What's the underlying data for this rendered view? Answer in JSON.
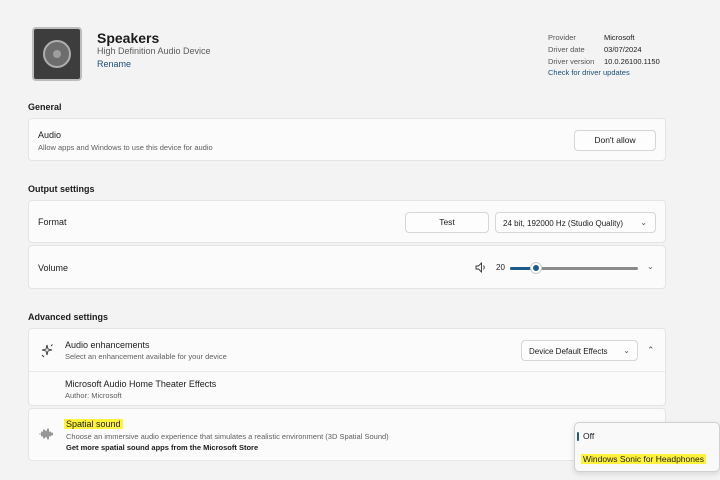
{
  "device": {
    "name": "Speakers",
    "description": "High Definition Audio Device",
    "rename_label": "Rename"
  },
  "driver": {
    "labels": [
      "Provider",
      "Driver date",
      "Driver version"
    ],
    "values": [
      "Microsoft",
      "03/07/2024",
      "10.0.26100.1150"
    ],
    "update_link": "Check for driver updates"
  },
  "general": {
    "heading": "General",
    "audio": {
      "title": "Audio",
      "description": "Allow apps and Windows to use this device for audio",
      "button": "Don't allow"
    }
  },
  "output": {
    "heading": "Output settings",
    "format": {
      "label": "Format",
      "test_button": "Test",
      "selected": "24 bit, 192000 Hz (Studio Quality)"
    },
    "volume": {
      "label": "Volume",
      "value": "20",
      "level": 20
    }
  },
  "advanced": {
    "heading": "Advanced settings",
    "enhancements": {
      "title": "Audio enhancements",
      "description": "Select an enhancement available for your device",
      "selected": "Device Default Effects"
    },
    "theater": {
      "title": "Microsoft Audio Home Theater Effects",
      "author": "Author: Microsoft"
    },
    "spatial": {
      "title": "Spatial sound",
      "description": "Choose an immersive audio experience that simulates a realistic environment (3D Spatial Sound)",
      "store_link": "Get more spatial sound apps from the Microsoft Store",
      "options": [
        "Off",
        "Windows Sonic for Headphones"
      ]
    }
  },
  "colors": {
    "accent": "#1a5a8c",
    "highlight": "#fff23a",
    "background": "#f3f3f3",
    "card": "#fbfbfb"
  },
  "icons": [
    "speaker-device-icon",
    "volume-icon",
    "enhancement-icon",
    "spatial-sound-icon",
    "chevron-down-icon",
    "chevron-up-icon"
  ]
}
